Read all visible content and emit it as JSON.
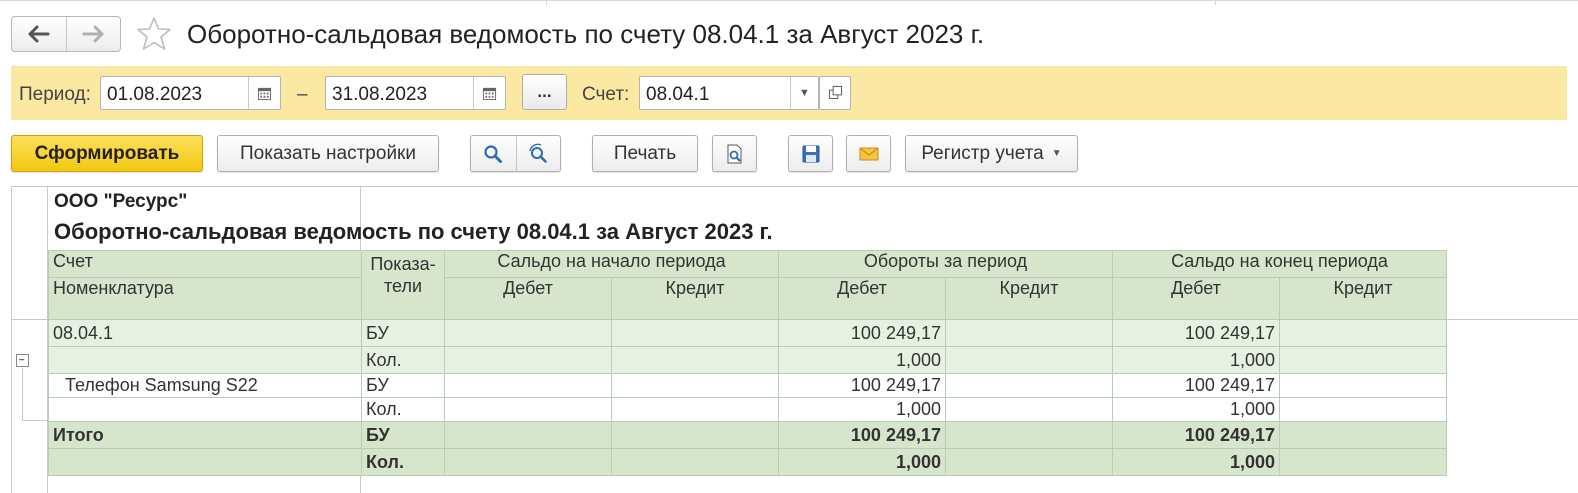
{
  "window": {
    "title": "Оборотно-сальдовая ведомость по счету 08.04.1 за Август 2023 г.",
    "nav_back_icon": "arrow-left-icon",
    "nav_forward_icon": "arrow-right-icon",
    "favorite_icon": "star-icon"
  },
  "filters": {
    "period_label": "Период:",
    "date_from": "01.08.2023",
    "dash": "–",
    "date_to": "31.08.2023",
    "period_select_label": "...",
    "account_label": "Счет:",
    "account_value": "08.04.1"
  },
  "toolbar": {
    "generate_label": "Сформировать",
    "settings_label": "Показать настройки",
    "print_label": "Печать",
    "register_label": "Регистр учета"
  },
  "report": {
    "organization": "ООО \"Ресурс\"",
    "title": "Оборотно-сальдовая ведомость по счету 08.04.1 за Август 2023 г.",
    "headers": {
      "account": "Счет",
      "nomenclature": "Номенклатура",
      "indicators": "Показа- тели",
      "opening": "Сальдо на начало периода",
      "turnover": "Обороты за период",
      "closing": "Сальдо на конец периода",
      "debit": "Дебет",
      "credit": "Кредит"
    },
    "rows": [
      {
        "name": "08.04.1",
        "ind": "БУ",
        "turnover_debit": "100 249,17",
        "closing_debit": "100 249,17"
      },
      {
        "name": "",
        "ind": "Кол.",
        "turnover_debit": "1,000",
        "closing_debit": "1,000"
      },
      {
        "name": "Телефон Samsung S22",
        "ind": "БУ",
        "turnover_debit": "100 249,17",
        "closing_debit": "100 249,17"
      },
      {
        "name": "",
        "ind": "Кол.",
        "turnover_debit": "1,000",
        "closing_debit": "1,000"
      },
      {
        "name": "Итого",
        "ind": "БУ",
        "turnover_debit": "100 249,17",
        "closing_debit": "100 249,17"
      },
      {
        "name": "",
        "ind": "Кол.",
        "turnover_debit": "1,000",
        "closing_debit": "1,000"
      }
    ]
  },
  "colors": {
    "panel_bg": "#fbe9a3",
    "primary_button": "#f2c80f",
    "header_bg": "#d6e5cc",
    "account_row_bg": "#e7f1e1"
  }
}
